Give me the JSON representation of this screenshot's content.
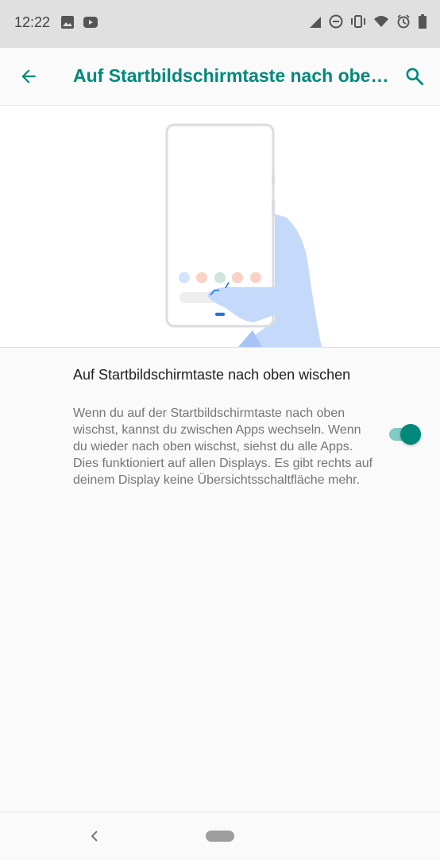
{
  "status_bar": {
    "time": "12:22",
    "left_icons": [
      "image-icon",
      "youtube-icon"
    ],
    "right_icons": [
      "signal-icon",
      "do-not-disturb-icon",
      "vibrate-icon",
      "wifi-icon",
      "alarm-icon",
      "battery-icon"
    ]
  },
  "app_bar": {
    "title": "Auf Startbildschirmtaste nach oben wischen",
    "back_icon": "arrow-back-icon",
    "search_icon": "search-icon"
  },
  "setting": {
    "title": "Auf Startbildschirmtaste nach oben wischen",
    "description": "Wenn du auf der Startbildschirmtaste nach oben wischst, kannst du zwischen Apps wechseln. Wenn du wieder nach oben wischst, siehst du alle Apps. Dies funktioniert auf allen Displays. Es gibt rechts auf deinem Display keine Übersichtsschaltfläche mehr.",
    "enabled": true
  },
  "colors": {
    "accent": "#00897b",
    "switch_track": "#80cbc4",
    "status_bar_bg": "#e0e0e0",
    "hand": "#c5d9fb"
  },
  "nav_bar": {
    "back_icon": "nav-back-icon",
    "home_icon": "home-pill-icon"
  }
}
